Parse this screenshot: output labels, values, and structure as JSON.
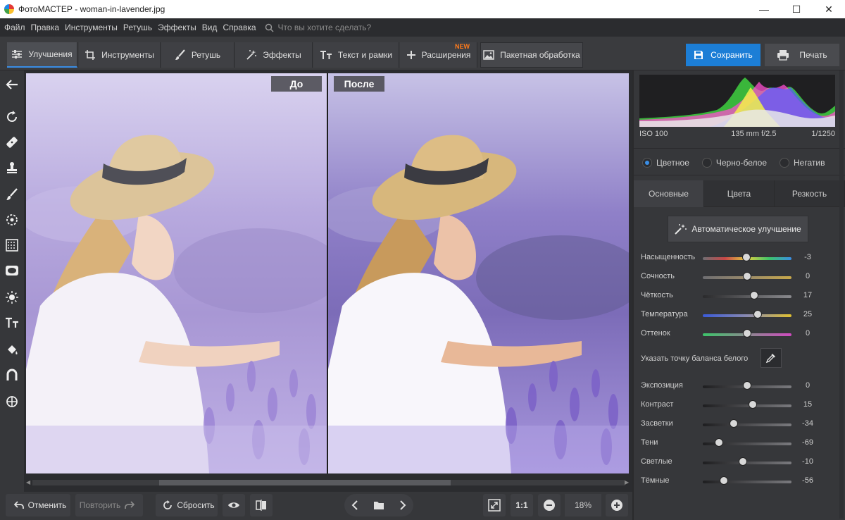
{
  "window": {
    "title": "ФотоМАСТЕР - woman-in-lavender.jpg",
    "minimize": "—",
    "maximize": "☐",
    "close": "✕"
  },
  "menu": {
    "items": [
      "Файл",
      "Правка",
      "Инструменты",
      "Ретушь",
      "Эффекты",
      "Вид",
      "Справка"
    ],
    "search_placeholder": "Что вы хотите сделать?"
  },
  "toolbar": {
    "tabs": [
      {
        "label": "Улучшения",
        "icon": "sliders-icon",
        "active": true
      },
      {
        "label": "Инструменты",
        "icon": "crop-icon",
        "active": false
      },
      {
        "label": "Ретушь",
        "icon": "brush-icon",
        "active": false
      },
      {
        "label": "Эффекты",
        "icon": "sparkle-icon",
        "active": false
      },
      {
        "label": "Текст и рамки",
        "icon": "text-icon",
        "active": false
      },
      {
        "label": "Расширения",
        "icon": "plus-icon",
        "active": false,
        "badge": "NEW"
      },
      {
        "label": "Пакетная обработка",
        "icon": "images-icon",
        "active": false
      }
    ],
    "save_label": "Сохранить",
    "print_label": "Печать",
    "accent": "#1c7ed6"
  },
  "left_tools": [
    "back-arrow-icon",
    "rotate-icon",
    "patch-icon",
    "stamp-icon",
    "brush-icon",
    "radial-icon",
    "gradient-filter-icon",
    "vignette-icon",
    "light-icon",
    "text-icon",
    "fill-icon",
    "magnet-icon",
    "target-icon"
  ],
  "canvas": {
    "before_label": "До",
    "after_label": "После"
  },
  "bottom": {
    "undo_label": "Отменить",
    "redo_label": "Повторить",
    "reset_label": "Сбросить",
    "zoom_ratio": "1:1",
    "zoom_value": "18%"
  },
  "histogram": {
    "iso": "ISO 100",
    "lens": "135 mm f/2.5",
    "shutter": "1/1250"
  },
  "modes": {
    "color": "Цветное",
    "bw": "Черно-белое",
    "negative": "Негатив",
    "selected": "color"
  },
  "panel_tabs": [
    "Основные",
    "Цвета",
    "Резкость"
  ],
  "auto_enhance_label": "Автоматическое улучшение",
  "white_balance_label": "Указать точку баланса белого",
  "color_sliders": [
    {
      "label": "Насыщенность",
      "value": "-3",
      "fraction": 0.49
    },
    {
      "label": "Сочность",
      "value": "0",
      "fraction": 0.5
    },
    {
      "label": "Чёткость",
      "value": "17",
      "fraction": 0.58
    },
    {
      "label": "Температура",
      "value": "25",
      "fraction": 0.62
    },
    {
      "label": "Оттенок",
      "value": "0",
      "fraction": 0.5
    }
  ],
  "light_sliders": [
    {
      "label": "Экспозиция",
      "value": "0",
      "fraction": 0.5
    },
    {
      "label": "Контраст",
      "value": "15",
      "fraction": 0.56
    },
    {
      "label": "Засветки",
      "value": "-34",
      "fraction": 0.35
    },
    {
      "label": "Тени",
      "value": "-69",
      "fraction": 0.18
    },
    {
      "label": "Светлые",
      "value": "-10",
      "fraction": 0.45
    },
    {
      "label": "Тёмные",
      "value": "-56",
      "fraction": 0.24
    }
  ]
}
